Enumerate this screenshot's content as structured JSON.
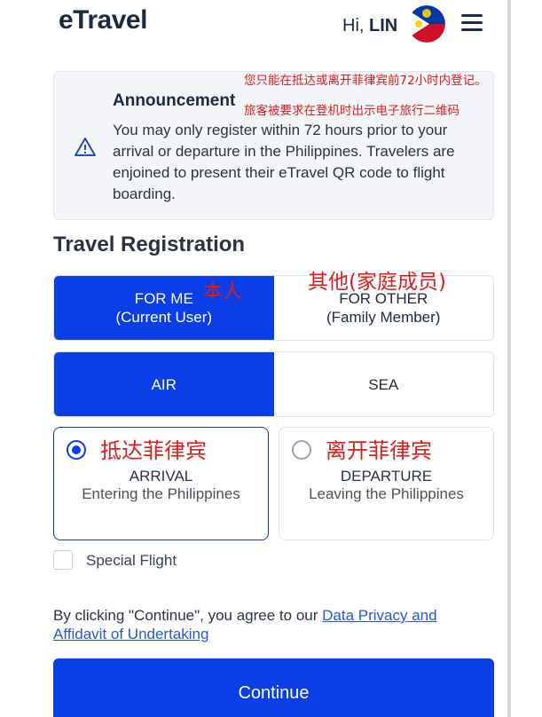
{
  "header": {
    "logo_text": "eTravel",
    "greeting": "Hi,",
    "user_name": "LIN"
  },
  "announcement": {
    "title": "Announcement",
    "body": "You may only register within 72 hours prior to your arrival or departure in the Philippines. Travelers are enjoined to present their eTravel QR code to flight boarding.",
    "note_line1": "您只能在抵达或离开菲律宾前72小时内登记。",
    "note_line2": "旅客被要求在登机时出示电子旅行二维码"
  },
  "registration": {
    "title": "Travel Registration",
    "for_me_label": "FOR ME",
    "for_me_sub": "(Current User)",
    "for_me_note": "本人",
    "for_other_label": "FOR OTHER",
    "for_other_sub": "(Family Member)",
    "for_other_note": "其他(家庭成员)",
    "air_label": "AIR",
    "sea_label": "SEA",
    "arrival_note": "抵达菲律宾",
    "arrival_title": "ARRIVAL",
    "arrival_sub": "Entering the Philippines",
    "departure_note": "离开菲律宾",
    "departure_title": "DEPARTURE",
    "departure_sub": "Leaving the Philippines",
    "special_flight_label": "Special Flight"
  },
  "consent": {
    "prefix": "By clicking \"Continue\", you agree to our ",
    "link_text": "Data Privacy and Affidavit of Undertaking"
  },
  "continue_label": "Continue",
  "colors": {
    "primary": "#0a3ee6",
    "annotation_red": "#d81e1e",
    "text_dark": "#1c2a3d"
  }
}
